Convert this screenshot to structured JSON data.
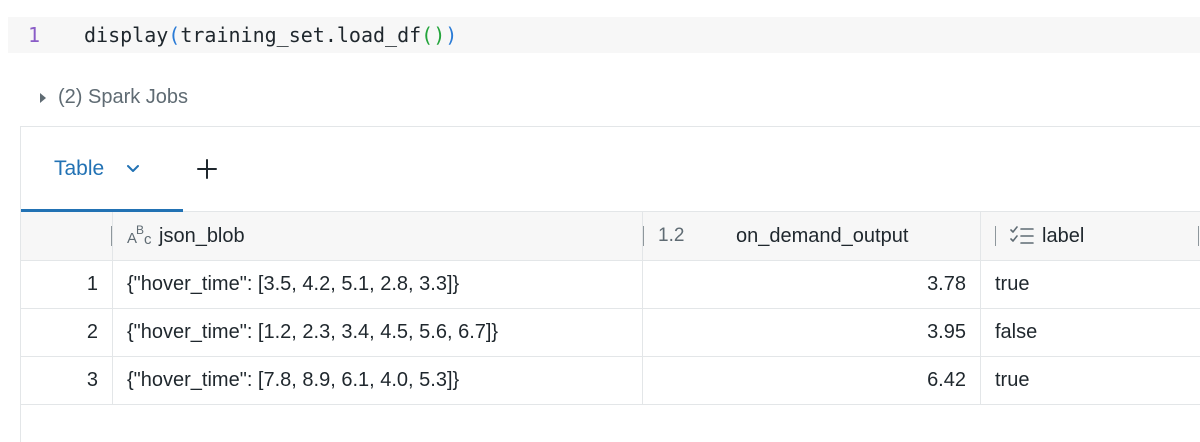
{
  "code_cell": {
    "line_number": "1",
    "code_prefix": "display",
    "code_open_paren": "(",
    "code_body": "training_set.load_df",
    "code_inner_parens": "()",
    "code_close_paren": ")"
  },
  "spark_jobs": {
    "label": "(2) Spark Jobs"
  },
  "tabs": {
    "active_label": "Table",
    "add_icon": "plus-icon",
    "chevron_icon": "chevron-down-icon",
    "accent_color": "#2272b4"
  },
  "table": {
    "columns": [
      {
        "name": "json_blob",
        "type_icon": "string-type-icon",
        "type_text": "ABC"
      },
      {
        "name": "on_demand_output",
        "type_icon": "number-type-icon",
        "type_text": "1.2"
      },
      {
        "name": "label",
        "type_icon": "list-check-icon"
      }
    ],
    "rows": [
      {
        "index": "1",
        "json_blob": "{\"hover_time\": [3.5, 4.2, 5.1, 2.8, 3.3]}",
        "on_demand_output": "3.78",
        "label": "true"
      },
      {
        "index": "2",
        "json_blob": "{\"hover_time\": [1.2, 2.3, 3.4, 4.5, 5.6, 6.7]}",
        "on_demand_output": "3.95",
        "label": "false"
      },
      {
        "index": "3",
        "json_blob": "{\"hover_time\": [7.8, 8.9, 6.1, 4.0, 5.3]}",
        "on_demand_output": "6.42",
        "label": "true"
      }
    ]
  }
}
